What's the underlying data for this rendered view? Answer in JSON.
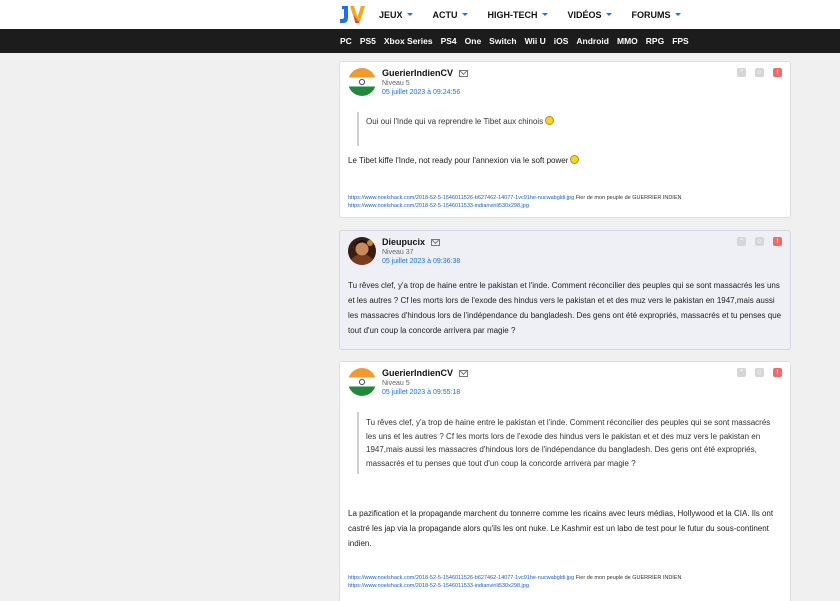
{
  "header": {
    "logo": "JV",
    "nav": [
      {
        "label": "JEUX"
      },
      {
        "label": "ACTU"
      },
      {
        "label": "HIGH-TECH"
      },
      {
        "label": "VIDÉOS"
      },
      {
        "label": "FORUMS"
      }
    ],
    "subnav": [
      "PC",
      "PS5",
      "Xbox Series",
      "PS4",
      "One",
      "Switch",
      "Wii U",
      "iOS",
      "Android",
      "MMO",
      "RPG",
      "FPS"
    ]
  },
  "colors": {
    "accent": "#1a73e8",
    "subbar": "#1c1c1c",
    "alert": "#ef6b6b"
  },
  "posts": [
    {
      "author": "GuerierIndienCV",
      "level": "Niveau 5",
      "date": "05 juillet 2023 à 09:24:56",
      "quote": "Oui oui l'Inde qui va reprendre le Tibet aux chinois",
      "text": "Le Tibet kiffe l'Inde, not ready pour l'annexion via le soft power",
      "link1": "https://www.noelshack.com/2018-52-5-1546011526-b627462-14077-1vc91he-nucwabgldi.jpg",
      "link1_suffix": "Fier de mon peuple de GUERRIER INDIEN",
      "link2": "https://www.noelshack.com/2018-52-5-1546011533-indianvirili530x298.jpg"
    },
    {
      "author": "Dieupucix",
      "level": "Niveau 37",
      "date": "05 juillet 2023 à 09:36:38",
      "text": "Tu rêves clef, y'a trop de haine entre le pakistan et l'inde. Comment réconcilier des peuples qui se sont massacrés les uns et les autres ? Cf les morts lors de l'exode des hindus vers le pakistan et et des muz vers le pakistan en 1947,mais aussi les massacres d'hindous lors de l'indépendance du bangladesh. Des gens ont été expropriés, massacrés et tu penses que tout d'un coup la concorde arrivera par magie ?"
    },
    {
      "author": "GuerierIndienCV",
      "level": "Niveau 5",
      "date": "05 juillet 2023 à 09:55:18",
      "quote": "Tu rêves clef, y'a trop de haine entre le pakistan et l'inde. Comment réconcilier des peuples qui se sont massacrés les uns et les autres ? Cf les morts lors de l'exode des hindus vers le pakistan et et des muz vers le pakistan en 1947,mais aussi les massacres d'hindous lors de l'indépendance du bangladesh. Des gens ont été expropriés, massacrés et tu penses que tout d'un coup la concorde arrivera par magie ?",
      "text": "La pazification et la propagande marchent du tonnerre comme les ricains avec leurs médias, Hollywood et la CIA. Ils ont castré les jap via la propagande alors qu'ils les ont nuke. Le Kashmir est un labo de test pour le futur du sous-continent indien.",
      "link1": "https://www.noelshack.com/2018-52-5-1546011526-b627462-14077-1vc91he-nucwabgldi.jpg",
      "link1_suffix": "Fier de mon peuple de GUERRIER INDIEN",
      "link2": "https://www.noelshack.com/2018-52-5-1546011533-indianvirili530x298.jpg"
    }
  ]
}
